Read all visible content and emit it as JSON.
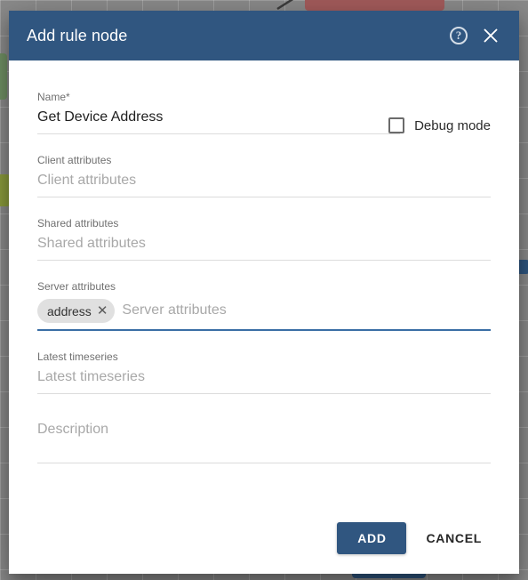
{
  "dialog": {
    "title": "Add rule node",
    "help_icon": "help-circle-icon",
    "help_glyph": "?",
    "close_icon": "close-icon",
    "close_glyph": "×",
    "header_color": "#305680"
  },
  "form": {
    "name": {
      "label": "Name",
      "required_marker": "*",
      "value": "Get Device Address",
      "placeholder": "Name"
    },
    "debug": {
      "label": "Debug mode",
      "checked": false
    },
    "client_attributes": {
      "label": "Client attributes",
      "placeholder": "Client attributes",
      "value": ""
    },
    "shared_attributes": {
      "label": "Shared attributes",
      "placeholder": "Shared attributes",
      "value": ""
    },
    "server_attributes": {
      "label": "Server attributes",
      "placeholder": "Server attributes",
      "chips": [
        {
          "text": "address",
          "remove_glyph": "✕"
        }
      ],
      "focused": true,
      "focus_color": "#3a6ea5"
    },
    "latest_timeseries": {
      "label": "Latest timeseries",
      "placeholder": "Latest timeseries",
      "value": ""
    },
    "description": {
      "placeholder": "Description",
      "value": ""
    }
  },
  "footer": {
    "add_label": "ADD",
    "cancel_label": "CANCEL",
    "add_color": "#305680"
  }
}
